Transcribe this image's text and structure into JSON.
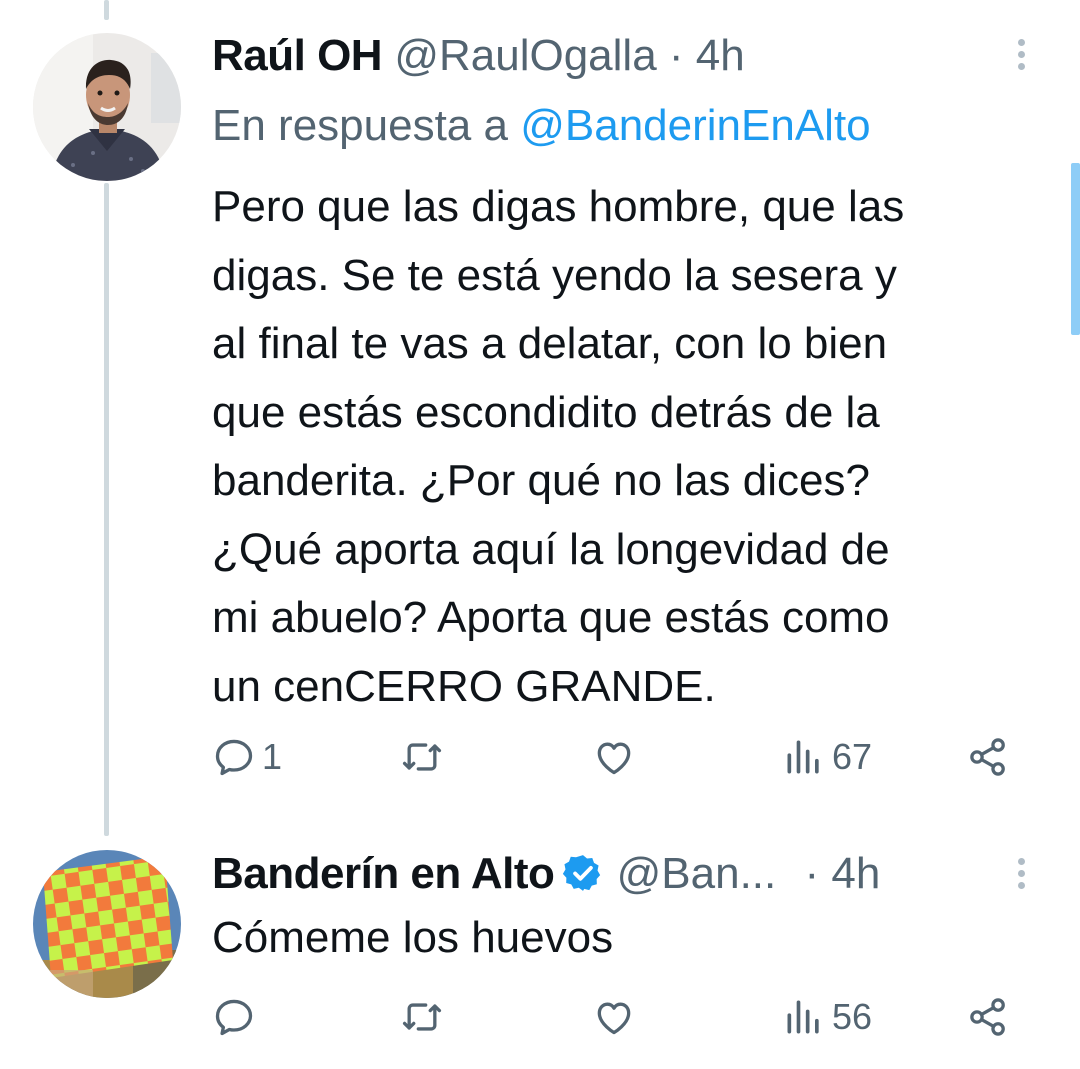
{
  "tweets": [
    {
      "name": "Raúl OH",
      "handle": "@RaulOgalla",
      "separator": "·",
      "time": "4h",
      "reply_prefix": "En respuesta a",
      "reply_mention": "@BanderinEnAlto",
      "text": "Pero que las digas hombre, que las\ndigas. Se te está yendo la sesera y\nal final te vas a delatar, con lo bien\nque estás escondidito detrás de la\nbanderita. ¿Por qué no las dices?\n¿Qué aporta aquí la longevidad de\nmi abuelo? Aporta que estás como\nun cenCERRO GRANDE.",
      "reply_count": "1",
      "retweet_count": "",
      "like_count": "",
      "view_count": "67"
    },
    {
      "name": "Banderín en Alto",
      "verified": true,
      "handle": "@Ban...",
      "separator": "·",
      "time": "4h",
      "text": "Cómeme los huevos",
      "reply_count": "",
      "retweet_count": "",
      "like_count": "",
      "view_count": "56"
    }
  ],
  "icons": {
    "reply": "reply-icon",
    "retweet": "retweet-icon",
    "like": "heart-icon",
    "views": "views-icon",
    "share": "share-icon",
    "more": "more-vertical-icon",
    "verified": "verified-badge-icon"
  },
  "colors": {
    "text": "#0f1419",
    "secondary": "#536471",
    "accent": "#1d9bf0",
    "thread_line": "#cfd9de"
  }
}
